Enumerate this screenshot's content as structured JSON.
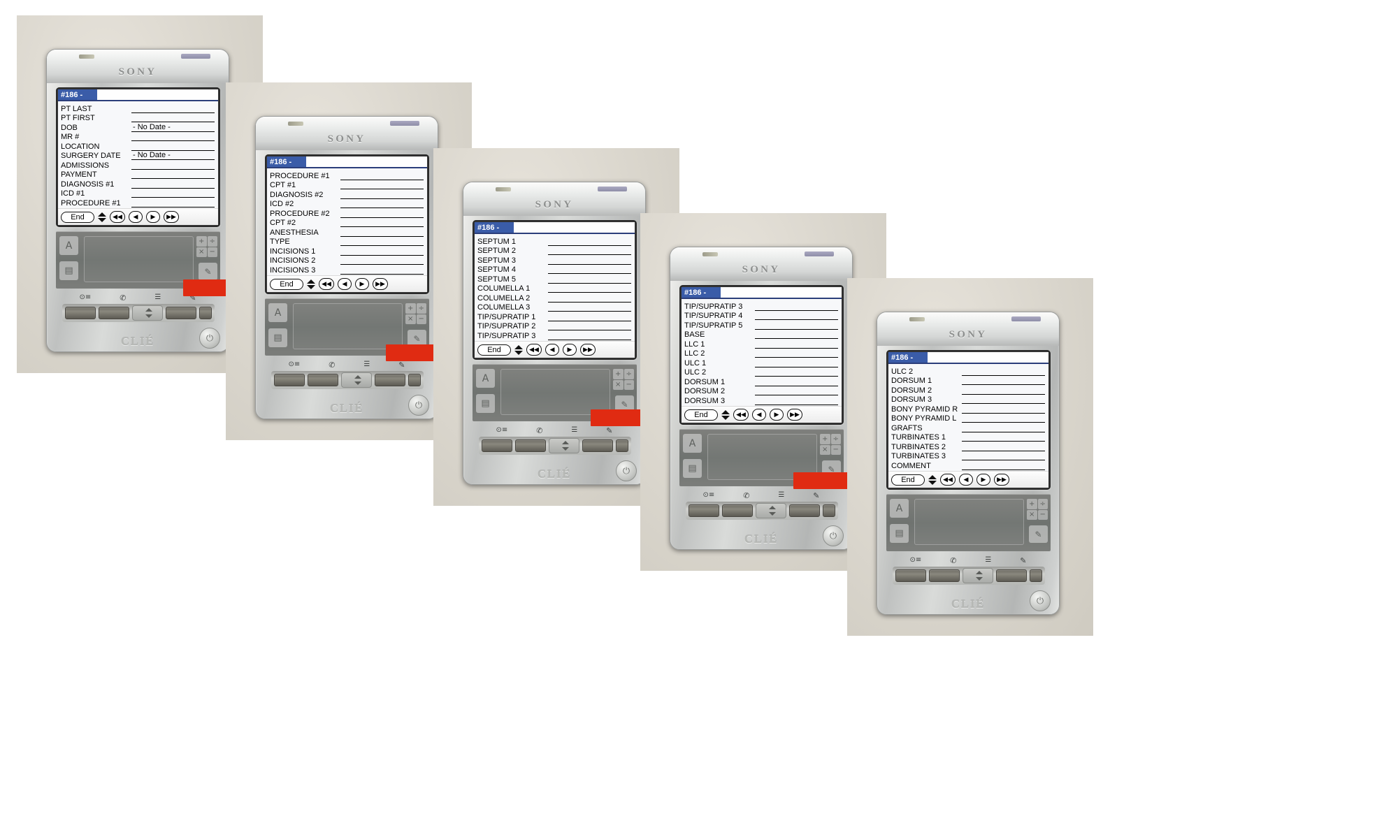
{
  "meta": {
    "brand_top": "SONY",
    "brand_bottom": "CLIÉ",
    "record_title": "#186 -",
    "end_label": "End",
    "power_glyph": "⏻"
  },
  "icons": {
    "nav_first": "◀◀",
    "nav_prev": "◀",
    "nav_next": "▶",
    "nav_last": "▶▶",
    "spin_up": "▲",
    "spin_down": "▼",
    "hw_home": "⊙≡",
    "hw_phone": "✆",
    "hw_list": "☰",
    "hw_note": "✎",
    "graffiti_abc": "A",
    "graffiti_num": "123",
    "calc_plus": "+",
    "calc_div": "÷",
    "calc_mult": "×",
    "calc_minus": "−"
  },
  "devices": [
    {
      "id": "device-1",
      "screen_name": "patient-demographics-screen",
      "title": "#186 -",
      "fields": [
        {
          "label": "PT LAST",
          "value": ""
        },
        {
          "label": "PT FIRST",
          "value": ""
        },
        {
          "label": "DOB",
          "value": "- No Date -"
        },
        {
          "label": "MR #",
          "value": ""
        },
        {
          "label": "LOCATION",
          "value": ""
        },
        {
          "label": "SURGERY DATE",
          "value": "- No Date -"
        },
        {
          "label": "ADMISSIONS",
          "value": ""
        },
        {
          "label": "PAYMENT",
          "value": ""
        },
        {
          "label": "DIAGNOSIS #1",
          "value": ""
        },
        {
          "label": "ICD #1",
          "value": ""
        },
        {
          "label": "PROCEDURE #1",
          "value": ""
        }
      ]
    },
    {
      "id": "device-2",
      "screen_name": "procedure-coding-screen",
      "title": "#186 -",
      "fields": [
        {
          "label": "PROCEDURE #1",
          "value": ""
        },
        {
          "label": "CPT #1",
          "value": ""
        },
        {
          "label": "DIAGNOSIS #2",
          "value": ""
        },
        {
          "label": "ICD #2",
          "value": ""
        },
        {
          "label": "PROCEDURE #2",
          "value": ""
        },
        {
          "label": "CPT #2",
          "value": ""
        },
        {
          "label": "ANESTHESIA",
          "value": ""
        },
        {
          "label": "TYPE",
          "value": ""
        },
        {
          "label": "INCISIONS 1",
          "value": ""
        },
        {
          "label": "INCISIONS 2",
          "value": ""
        },
        {
          "label": "INCISIONS 3",
          "value": ""
        }
      ]
    },
    {
      "id": "device-3",
      "screen_name": "septum-columella-tip-screen",
      "title": "#186 -",
      "fields": [
        {
          "label": "SEPTUM 1",
          "value": ""
        },
        {
          "label": "SEPTUM 2",
          "value": ""
        },
        {
          "label": "SEPTUM 3",
          "value": ""
        },
        {
          "label": "SEPTUM 4",
          "value": ""
        },
        {
          "label": "SEPTUM 5",
          "value": ""
        },
        {
          "label": "COLUMELLA 1",
          "value": ""
        },
        {
          "label": "COLUMELLA 2",
          "value": ""
        },
        {
          "label": "COLUMELLA 3",
          "value": ""
        },
        {
          "label": "TIP/SUPRATIP 1",
          "value": ""
        },
        {
          "label": "TIP/SUPRATIP 2",
          "value": ""
        },
        {
          "label": "TIP/SUPRATIP 3",
          "value": ""
        }
      ]
    },
    {
      "id": "device-4",
      "screen_name": "tip-base-cartilage-dorsum-screen",
      "title": "#186 -",
      "fields": [
        {
          "label": "TIP/SUPRATIP 3",
          "value": ""
        },
        {
          "label": "TIP/SUPRATIP 4",
          "value": ""
        },
        {
          "label": "TIP/SUPRATIP 5",
          "value": ""
        },
        {
          "label": "BASE",
          "value": ""
        },
        {
          "label": "LLC 1",
          "value": ""
        },
        {
          "label": "LLC 2",
          "value": ""
        },
        {
          "label": "ULC 1",
          "value": ""
        },
        {
          "label": "ULC 2",
          "value": ""
        },
        {
          "label": "DORSUM 1",
          "value": ""
        },
        {
          "label": "DORSUM 2",
          "value": ""
        },
        {
          "label": "DORSUM 3",
          "value": ""
        }
      ]
    },
    {
      "id": "device-5",
      "screen_name": "pyramid-grafts-turbinates-screen",
      "title": "#186 -",
      "fields": [
        {
          "label": "ULC 2",
          "value": ""
        },
        {
          "label": "DORSUM 1",
          "value": ""
        },
        {
          "label": "DORSUM 2",
          "value": ""
        },
        {
          "label": "DORSUM 3",
          "value": ""
        },
        {
          "label": "BONY PYRAMID R",
          "value": ""
        },
        {
          "label": "BONY PYRAMID L",
          "value": ""
        },
        {
          "label": "GRAFTS",
          "value": ""
        },
        {
          "label": "TURBINATES 1",
          "value": ""
        },
        {
          "label": "TURBINATES 2",
          "value": ""
        },
        {
          "label": "TURBINATES 3",
          "value": ""
        },
        {
          "label": "COMMENT",
          "value": ""
        }
      ]
    }
  ],
  "colors": {
    "title_tab": "#3a5ca8",
    "arrow_red": "#e02b12",
    "lcd_bg": "#f7f8fa",
    "photo_bg": "#ded9d0",
    "frame_black": "#000000"
  }
}
